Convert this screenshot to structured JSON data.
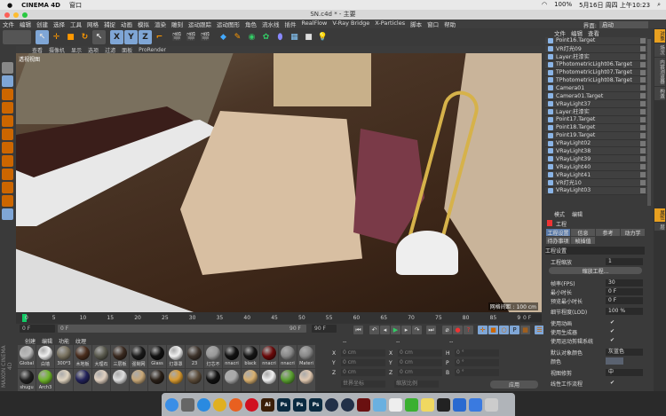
{
  "mac": {
    "app": "CINEMA 4D",
    "menu": "窗口",
    "battery": "100%",
    "datetime": "5月16日 周四 上午10:23"
  },
  "window": {
    "title": "SN.c4d * - 主要"
  },
  "menu": [
    "文件",
    "编辑",
    "创建",
    "选择",
    "工具",
    "网格",
    "捕捉",
    "动画",
    "模拟",
    "渲染",
    "雕刻",
    "运动跟踪",
    "运动图形",
    "角色",
    "流水线",
    "插件",
    "RealFlow",
    "V-Ray Bridge",
    "X-Particles",
    "脚本",
    "窗口",
    "帮助"
  ],
  "layout": {
    "label": "界面:",
    "value": "启动"
  },
  "toolbar": {
    "x": "X",
    "y": "Y",
    "z": "Z"
  },
  "viewport": {
    "menu": [
      "查看",
      "摄像机",
      "显示",
      "选项",
      "过滤",
      "面板",
      "ProRender"
    ],
    "label": "透视视图",
    "grid": "网格间距 : 100 cm"
  },
  "timeline": {
    "ticks": [
      "0",
      "5",
      "10",
      "15",
      "20",
      "25",
      "30",
      "35",
      "40",
      "45",
      "50",
      "55",
      "60",
      "65",
      "70",
      "75",
      "80",
      "85",
      "90"
    ],
    "current": "0 F",
    "start": "0 F",
    "range_start": "0 F",
    "range_end": "90 F",
    "end": "90 F",
    "right": "0 F"
  },
  "materials": {
    "menu": [
      "创建",
      "编辑",
      "功能",
      "纹理"
    ],
    "logo": "MAXON CINEMA 4D",
    "items": [
      {
        "name": "Global",
        "color": "#bbb"
      },
      {
        "name": "白墙",
        "color": "#eee"
      },
      {
        "name": "300*3",
        "color": "#7a7360"
      },
      {
        "name": "木地板",
        "color": "#4a2e1e"
      },
      {
        "name": "大理石",
        "color": "#5a5a4e"
      },
      {
        "name": "三层板",
        "color": "#3a2a20"
      },
      {
        "name": "强制网",
        "color": "#1a1a1a"
      },
      {
        "name": "Glass",
        "color": "#111"
      },
      {
        "name": "灯罩罩",
        "color": "#f0f0f0"
      },
      {
        "name": "23",
        "color": "#3e342c"
      },
      {
        "name": "灯芯不",
        "color": "#999"
      },
      {
        "name": "nnacri",
        "color": "#111"
      },
      {
        "name": "black",
        "color": "#151515"
      },
      {
        "name": "nnacri",
        "color": "#6a0a0a"
      },
      {
        "name": "nnacri",
        "color": "#888"
      },
      {
        "name": "Materi",
        "color": "#888"
      },
      {
        "name": "shugu",
        "color": "#222"
      },
      {
        "name": "Arch3",
        "color": "#6fb52a"
      },
      {
        "name": "",
        "color": "#e0d4c0"
      },
      {
        "name": "",
        "color": "#22225a"
      },
      {
        "name": "",
        "color": "#e0d0c0"
      },
      {
        "name": "",
        "color": "#ddd"
      },
      {
        "name": "",
        "color": "#c8a878"
      },
      {
        "name": "",
        "color": "#2a2018"
      },
      {
        "name": "",
        "color": "#d89a30"
      },
      {
        "name": "",
        "color": "#5a4a38"
      },
      {
        "name": "",
        "color": "#111"
      },
      {
        "name": "",
        "color": "#aaa"
      },
      {
        "name": "",
        "color": "#d8b070"
      },
      {
        "name": "",
        "color": "#f0f0f0"
      },
      {
        "name": "",
        "color": "#5aa030"
      },
      {
        "name": "",
        "color": "#e0c8b0"
      },
      {
        "name": "",
        "color": "#6a2a30"
      },
      {
        "name": "",
        "color": "#222"
      },
      {
        "name": "",
        "color": "#1a1410"
      }
    ]
  },
  "coords": {
    "header": [
      "--",
      "--",
      "--"
    ],
    "rows": [
      [
        "X",
        "0 cm",
        "X",
        "0 cm",
        "H",
        "0 °"
      ],
      [
        "Y",
        "0 cm",
        "Y",
        "0 cm",
        "P",
        "0 °"
      ],
      [
        "Z",
        "0 cm",
        "Z",
        "0 cm",
        "B",
        "0 °"
      ]
    ],
    "mode1": "世界坐标",
    "mode2": "缩放比例",
    "apply": "应用"
  },
  "objects": {
    "menu": [
      "文件",
      "编辑",
      "查看"
    ],
    "items": [
      "Point16.Target",
      "VR灯光09",
      "Layer:柱漆实",
      "TPhotometricLight06.Target",
      "TPhotometricLight07.Target",
      "TPhotometricLight08.Target",
      "Camera01",
      "Camera01.Target",
      "VRayLight37",
      "Layer:柱漆实",
      "Point17.Target",
      "Point18.Target",
      "Point19.Target",
      "VRayLight02",
      "VRayLight38",
      "VRayLight39",
      "VRayLight40",
      "VRayLight41",
      "VR灯光10",
      "VRayLight03"
    ]
  },
  "sidetabs": [
    "对象",
    "场次",
    "内容浏览器",
    "构造"
  ],
  "sidetabs2": [
    "属性",
    "层"
  ],
  "attributes": {
    "menu": [
      "模式",
      "编辑"
    ],
    "title": "工程",
    "tabs": [
      "工程设置",
      "信息",
      "参考",
      "动力学",
      "待办事项",
      "帧插值"
    ],
    "section": "工程设置",
    "scale_label": "工程缩放",
    "scale": "1",
    "scale_btn": "缩放工程...",
    "fps_label": "帧率(FPS)",
    "fps": "30",
    "min_label": "最小时长",
    "min": "0 F",
    "pmin_label": "预览最小时长",
    "pmin": "0 F",
    "lod_label": "细节程度(LOD)",
    "lod": "100 %",
    "use_anim": "使用动画",
    "use_gen": "使用生成器",
    "use_motion": "使用运动剪辑系统",
    "obj_color_label": "默认对象颜色",
    "obj_color": "灰蓝色",
    "color_label": "颜色",
    "color_value": "#5a6270",
    "clip_label": "视图修剪",
    "clip": "中",
    "linear": "线性工作流程"
  },
  "dock": [
    {
      "name": "finder",
      "color": "#3a8ee6",
      "t": ""
    },
    {
      "name": "launchpad",
      "color": "#666",
      "t": ""
    },
    {
      "name": "safari",
      "color": "#2a8ae0",
      "t": ""
    },
    {
      "name": "chrome",
      "color": "#e0b020",
      "t": ""
    },
    {
      "name": "firefox",
      "color": "#e86020",
      "t": ""
    },
    {
      "name": "opera",
      "color": "#d01020",
      "t": ""
    },
    {
      "name": "illustrator",
      "color": "#3a1e08",
      "t": "Ai"
    },
    {
      "name": "photoshop",
      "color": "#0a2a40",
      "t": "Ps"
    },
    {
      "name": "photoshop",
      "color": "#0a2a40",
      "t": "Ps"
    },
    {
      "name": "photoshop",
      "color": "#0a2a40",
      "t": "Ps"
    },
    {
      "name": "cinema4d",
      "color": "#223048",
      "t": ""
    },
    {
      "name": "cinema4d",
      "color": "#223048",
      "t": ""
    },
    {
      "name": "acrobat",
      "color": "#6a1010",
      "t": ""
    },
    {
      "name": "vectornator",
      "color": "#6ab0e0",
      "t": ""
    },
    {
      "name": "notes",
      "color": "#eee",
      "t": ""
    },
    {
      "name": "wechat",
      "color": "#3ab030",
      "t": ""
    },
    {
      "name": "stickies",
      "color": "#f0d860",
      "t": ""
    },
    {
      "name": "qq",
      "color": "#222",
      "t": ""
    },
    {
      "name": "teamviewer",
      "color": "#2a6ad0",
      "t": ""
    },
    {
      "name": "baidu-netdisk",
      "color": "#3a7ae0",
      "t": ""
    },
    {
      "name": "trash",
      "color": "#ccc",
      "t": ""
    }
  ]
}
